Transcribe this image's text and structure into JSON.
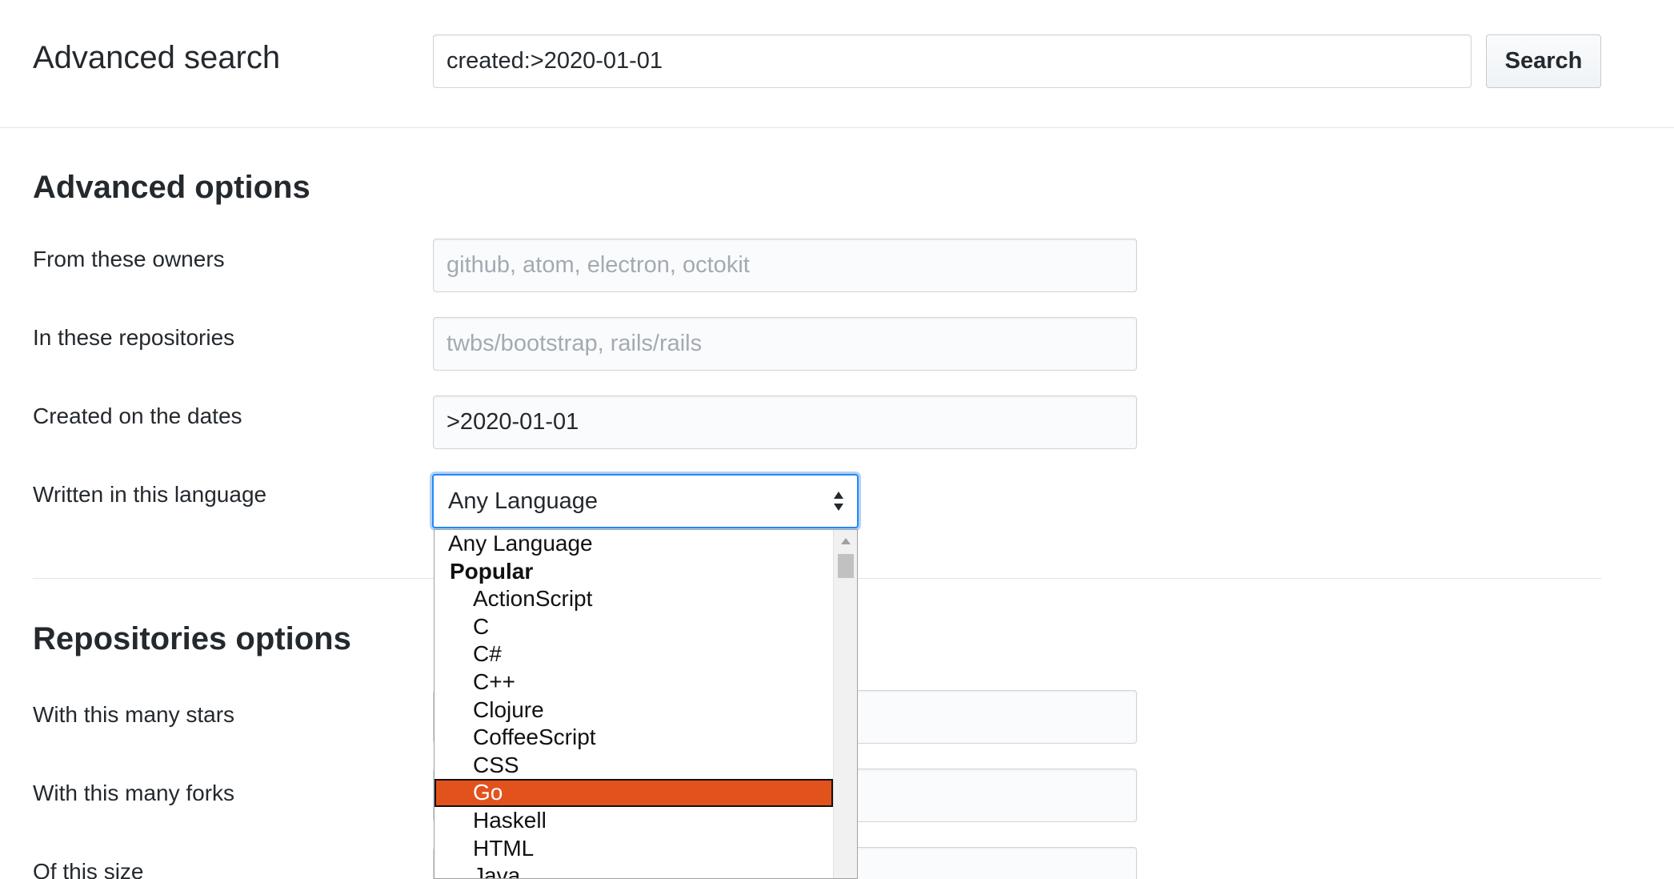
{
  "header": {
    "title": "Advanced search",
    "search_value": "created:>2020-01-01",
    "search_button": "Search"
  },
  "advanced": {
    "title": "Advanced options",
    "owners": {
      "label": "From these owners",
      "placeholder": "github, atom, electron, octokit",
      "value": ""
    },
    "repos": {
      "label": "In these repositories",
      "placeholder": "twbs/bootstrap, rails/rails",
      "value": ""
    },
    "dates": {
      "label": "Created on the dates",
      "value": ">2020-01-01"
    },
    "language": {
      "label": "Written in this language",
      "selected": "Any Language"
    }
  },
  "repo_options": {
    "title": "Repositories options",
    "stars_label": "With this many stars",
    "forks_label": "With this many forks",
    "size_label": "Of this size"
  },
  "dropdown": {
    "top_option": "Any Language",
    "group_label": "Popular",
    "options": [
      "ActionScript",
      "C",
      "C#",
      "C++",
      "Clojure",
      "CoffeeScript",
      "CSS",
      "Go",
      "Haskell",
      "HTML",
      "Java"
    ],
    "highlighted": "Go"
  },
  "colors": {
    "focus": "#2188ff",
    "highlight": "#e2521d"
  }
}
